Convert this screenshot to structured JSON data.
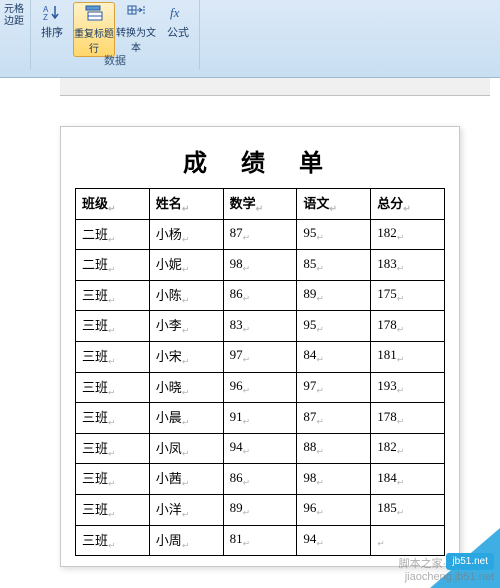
{
  "ribbon": {
    "left_fragment_top": "元格",
    "left_fragment_bot": "边距",
    "sort_label": "排序",
    "repeat_header_label": "重复标题行",
    "to_text_label": "转换为文本",
    "formula_label": "公式",
    "group_label": "数据"
  },
  "doc": {
    "title": "成 绩 单",
    "headers": [
      "班级",
      "姓名",
      "数学",
      "语文",
      "总分"
    ],
    "rows": [
      [
        "二班",
        "小杨",
        "87",
        "95",
        "182"
      ],
      [
        "二班",
        "小妮",
        "98",
        "85",
        "183"
      ],
      [
        "三班",
        "小陈",
        "86",
        "89",
        "175"
      ],
      [
        "三班",
        "小李",
        "83",
        "95",
        "178"
      ],
      [
        "三班",
        "小宋",
        "97",
        "84",
        "181"
      ],
      [
        "三班",
        "小晓",
        "96",
        "97",
        "193"
      ],
      [
        "三班",
        "小晨",
        "91",
        "87",
        "178"
      ],
      [
        "三班",
        "小凤",
        "94",
        "88",
        "182"
      ],
      [
        "三班",
        "小茜",
        "86",
        "98",
        "184"
      ],
      [
        "三班",
        "小洋",
        "89",
        "96",
        "185"
      ],
      [
        "三班",
        "小周",
        "81",
        "94",
        ""
      ]
    ]
  },
  "watermark": {
    "badge": "jb51.net",
    "line1": "脚本之家·教程·频道",
    "line2": "jiaocheng.jb51.net"
  }
}
